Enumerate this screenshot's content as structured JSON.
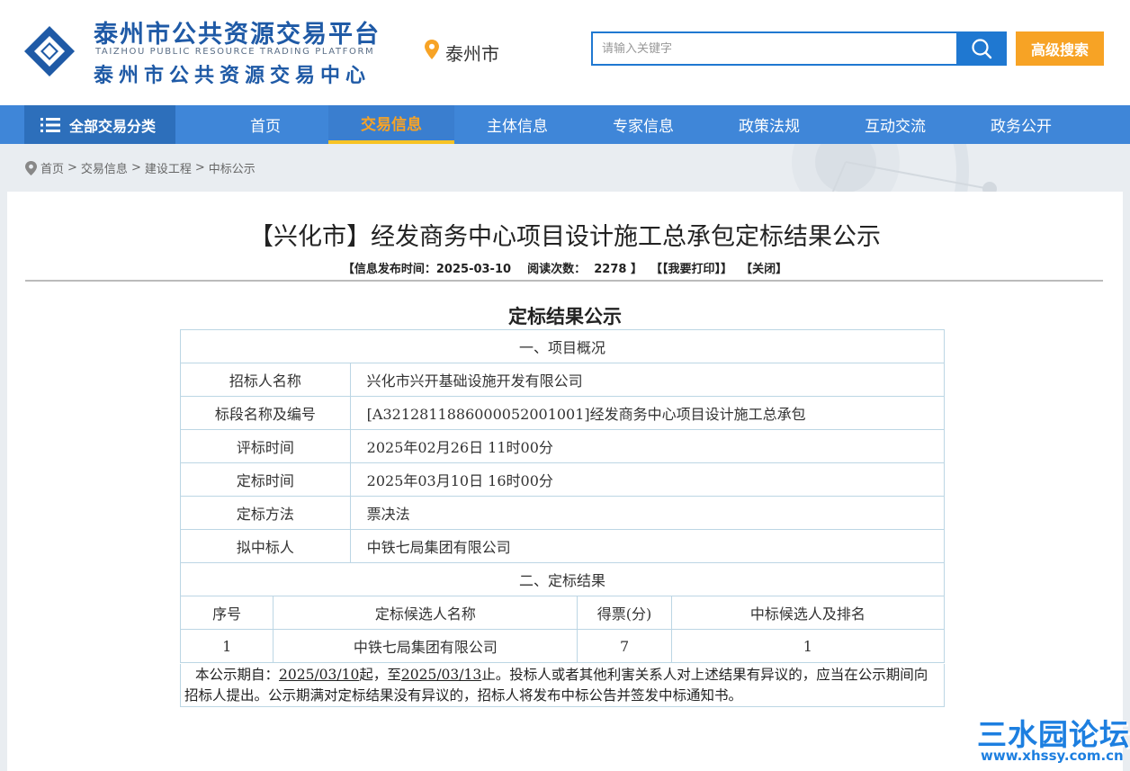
{
  "header": {
    "logo_cn": "泰州市公共资源交易平台",
    "logo_en": "TAIZHOU PUBLIC RESOURCE TRADING PLATFORM",
    "logo_cn2": "泰州市公共资源交易中心",
    "city": "泰州市",
    "search_placeholder": "请输入关键字",
    "advanced_search": "高级搜索"
  },
  "nav": {
    "all_categories": "全部交易分类",
    "items": [
      "首页",
      "交易信息",
      "主体信息",
      "专家信息",
      "政策法规",
      "互动交流",
      "政务公开"
    ],
    "active": "交易信息"
  },
  "breadcrumb": [
    "首页",
    "交易信息",
    "建设工程",
    "中标公示"
  ],
  "article": {
    "title": "【兴化市】经发商务中心项目设计施工总承包定标结果公示",
    "meta_publish_label": "【信息发布时间：",
    "publish_date": "2025-03-10",
    "meta_views_label": "阅读次数：",
    "views": "2278",
    "meta_close_bracket": "】",
    "print_link": "【【我要打印】】",
    "close_link": "【关闭】",
    "doc_title": "定标结果公示"
  },
  "table": {
    "section1": "一、项目概况",
    "rows": [
      {
        "label": "招标人名称",
        "value": "兴化市兴开基础设施开发有限公司"
      },
      {
        "label": "标段名称及编号",
        "value": "[A3212811886000052001001]经发商务中心项目设计施工总承包"
      },
      {
        "label": "评标时间",
        "value": "2025年02月26日 11时00分"
      },
      {
        "label": "定标时间",
        "value": "2025年03月10日 16时00分"
      },
      {
        "label": "定标方法",
        "value": "票决法"
      },
      {
        "label": "拟中标人",
        "value": "中铁七局集团有限公司"
      }
    ],
    "section2": "二、定标结果",
    "result_headers": [
      "序号",
      "定标候选人名称",
      "得票(分)",
      "中标候选人及排名"
    ],
    "result_rows": [
      {
        "no": "1",
        "name": "中铁七局集团有限公司",
        "votes": "7",
        "rank": "1"
      }
    ]
  },
  "notice": {
    "p1": "本公示期自：",
    "start": "2025/03/10",
    "p2": "起，至",
    "end": "2025/03/13",
    "p3": "止。投标人或者其他利害关系人对上述结果有异议的，应当在公示期间向招标人提出。公示期满对定标结果没有异议的，招标人将发布中标公告并签发中标通知书。"
  },
  "watermark": {
    "line1": "三水园论坛",
    "line2": "www.xhssy.com.cn"
  },
  "colors": {
    "brand_blue": "#1f5aa6",
    "nav_blue": "#3f86d8",
    "accent_orange": "#f7a325",
    "table_border": "#bcd6e4"
  }
}
